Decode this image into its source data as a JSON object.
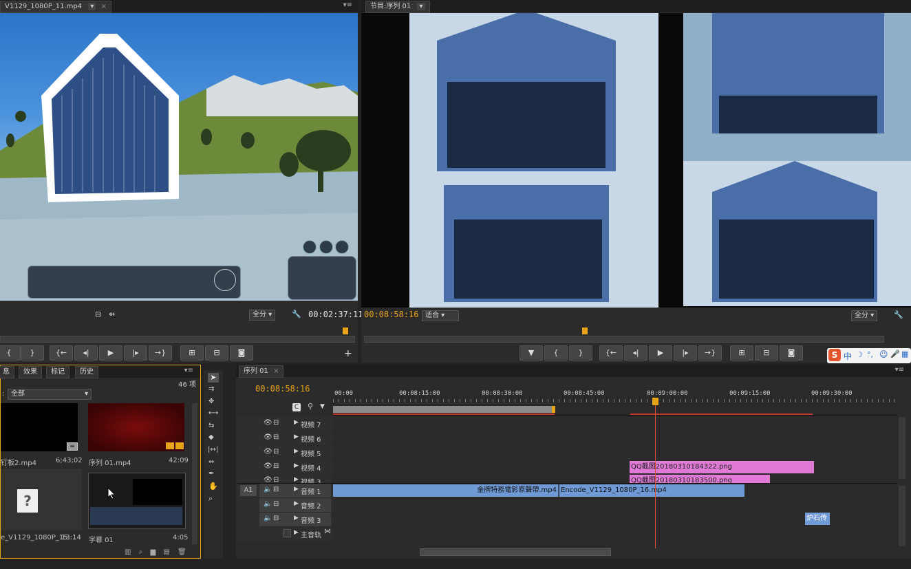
{
  "source_monitor": {
    "tab_label": "V1129_1080P_11.mp4",
    "fit_option": "全分",
    "timecode": "00:02:37:11"
  },
  "program_monitor": {
    "tab_label": "节目:序列 01",
    "timecode": "00:08:58:16",
    "fit_option": "适合",
    "quality_option": "全分"
  },
  "project_panel": {
    "tabs": [
      "息",
      "效果",
      "标记",
      "历史"
    ],
    "item_count": "46 项",
    "filter_label": "全部",
    "items": [
      {
        "name": "钉板2.mp4",
        "duration": "6;43;02"
      },
      {
        "name": "序列 01.mp4",
        "duration": "42:09"
      },
      {
        "name": "e_V1129_1080P_15....",
        "duration": "13:14"
      },
      {
        "name": "字幕 01",
        "duration": "4:05"
      }
    ]
  },
  "timeline": {
    "tab_label": "序列 01",
    "timecode": "00:08:58:16",
    "ruler": [
      "00:00",
      "00:08:15:00",
      "00:08:30:00",
      "00:08:45:00",
      "00:09:00:00",
      "00:09:15:00",
      "00:09:30:00"
    ],
    "video_tracks": [
      "视频 7",
      "视频 6",
      "视频 5",
      "视频 4",
      "视频 3"
    ],
    "audio_tracks": [
      "音频 1",
      "音频 2",
      "音频 3"
    ],
    "master_track": "主音轨",
    "a1_label": "A1",
    "clips": {
      "v4_clip": "QQ截图20180310184322.png",
      "v3_clip": "QQ截图20180310183500.png",
      "a1_clip_a": "金牌特務電影原聲帶.mp4",
      "a1_clip_b": "Encode_V1129_1080P_16.mp4",
      "a3_clip": "炉石传"
    }
  },
  "ime_toolbar": {
    "items": [
      "S",
      "中",
      "☽",
      "°,",
      "☺",
      "🎤",
      "▦"
    ]
  },
  "colors": {
    "accent_orange": "#e8a418",
    "clip_pink": "#e07ad6",
    "clip_blue": "#6f9ad6"
  }
}
